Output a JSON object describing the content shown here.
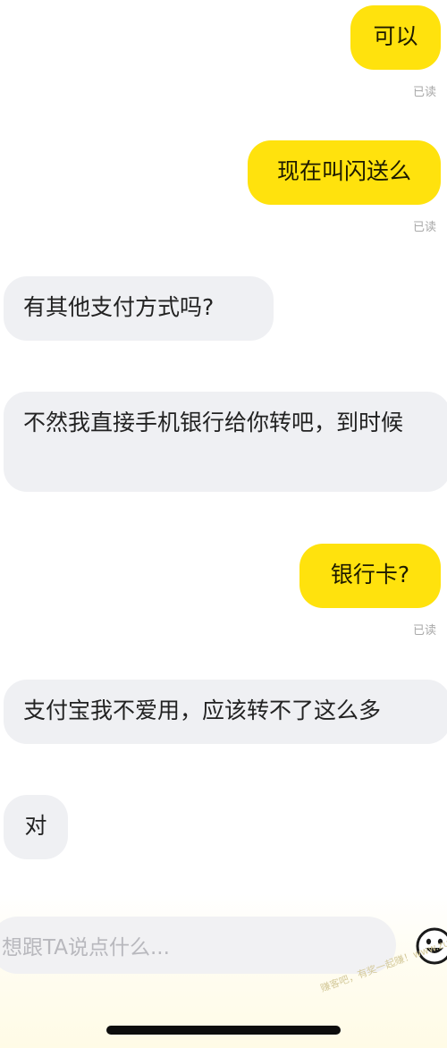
{
  "messages": [
    {
      "direction": "sent",
      "text": "可以",
      "read_label": "已读"
    },
    {
      "direction": "sent",
      "text": "现在叫闪送么",
      "read_label": "已读"
    },
    {
      "direction": "received",
      "text": "有其他支付方式吗?"
    },
    {
      "direction": "received",
      "text": "不然我直接手机银行给你转吧，到时候"
    },
    {
      "direction": "sent",
      "text": "银行卡?",
      "read_label": "已读"
    },
    {
      "direction": "received",
      "text": "支付宝我不爱用，应该转不了这么多"
    },
    {
      "direction": "received",
      "text": "对"
    }
  ],
  "composer": {
    "placeholder": "想跟TA说点什么...",
    "emoji_icon": "emoji-smile-icon"
  },
  "watermark": "赚客吧，有奖一起赚！www.zuanke8.com",
  "colors": {
    "sent_bubble": "#ffe20d",
    "received_bubble": "#eff0f3",
    "read_label": "#a9a9a9",
    "placeholder": "#b8b8bd"
  }
}
